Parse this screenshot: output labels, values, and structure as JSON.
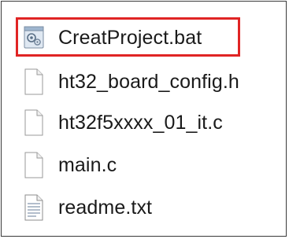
{
  "files": [
    {
      "name": "CreatProject.bat",
      "icon": "batch-file-icon",
      "highlighted": true
    },
    {
      "name": "ht32_board_config.h",
      "icon": "blank-file-icon",
      "highlighted": false
    },
    {
      "name": "ht32f5xxxx_01_it.c",
      "icon": "blank-file-icon",
      "highlighted": false
    },
    {
      "name": "main.c",
      "icon": "blank-file-icon",
      "highlighted": false
    },
    {
      "name": "readme.txt",
      "icon": "text-file-icon",
      "highlighted": false
    }
  ],
  "colors": {
    "highlight_border": "#e02424",
    "text": "#1a1a1a",
    "background": "#ffffff"
  }
}
